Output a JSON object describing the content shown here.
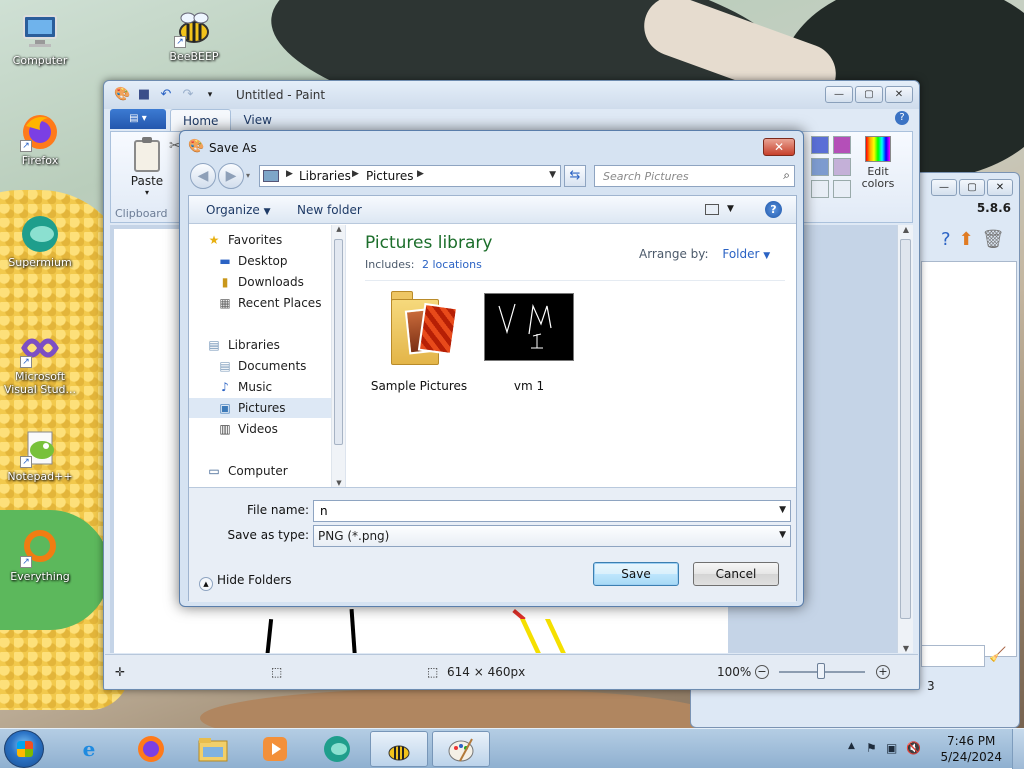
{
  "desktop": {
    "icons": [
      {
        "label": "Computer",
        "icon": "computer-icon"
      },
      {
        "label": "BeeBEEP",
        "icon": "bee-icon"
      },
      {
        "label": "Firefox",
        "icon": "firefox-icon"
      },
      {
        "label": "Supermium",
        "icon": "supermium-icon"
      },
      {
        "label": "Microsoft Visual Stud...",
        "icon": "visual-studio-icon"
      },
      {
        "label": "Notepad++",
        "icon": "notepad-plus-plus-icon"
      },
      {
        "label": "Everything",
        "icon": "everything-search-icon"
      }
    ]
  },
  "paint": {
    "title": "Untitled - Paint",
    "tabs": [
      "Home",
      "View"
    ],
    "paste_label": "Paste",
    "clipboard_group": "Clipboard",
    "edit_colors": "Edit colors",
    "canvas_size": "614 × 460px",
    "zoom": "100%",
    "swatch_colors": [
      "#5a6fd6",
      "#b44fb8",
      "#7d9bcf",
      "#c4b0d8",
      "#e8eef6",
      "#e8eef6"
    ]
  },
  "bg_window": {
    "version": "5.8.6",
    "number": "3"
  },
  "save_dialog": {
    "title": "Save As",
    "breadcrumb": [
      "Libraries",
      "Pictures"
    ],
    "search_placeholder": "Search Pictures",
    "toolbar": {
      "organize": "Organize",
      "new_folder": "New folder"
    },
    "nav": {
      "favorites": "Favorites",
      "favorites_items": [
        "Desktop",
        "Downloads",
        "Recent Places"
      ],
      "libraries": "Libraries",
      "libraries_items": [
        "Documents",
        "Music",
        "Pictures",
        "Videos"
      ],
      "computer": "Computer",
      "selected": "Pictures"
    },
    "library": {
      "title": "Pictures library",
      "includes_label": "Includes:",
      "includes_link": "2 locations",
      "arrange_label": "Arrange by:",
      "arrange_value": "Folder"
    },
    "files": [
      {
        "name": "Sample Pictures",
        "type": "folder"
      },
      {
        "name": "vm 1",
        "type": "image"
      }
    ],
    "file_name_label": "File name:",
    "file_name_value": "n",
    "save_type_label": "Save as type:",
    "save_type_value": "PNG (*.png)",
    "hide_folders": "Hide Folders",
    "save_button": "Save",
    "cancel_button": "Cancel"
  },
  "taskbar": {
    "apps": [
      "internet-explorer-icon",
      "firefox-icon",
      "file-explorer-icon",
      "media-player-icon",
      "supermium-icon",
      "bee-icon",
      "paint-icon"
    ],
    "time": "7:46 PM",
    "date": "5/24/2024"
  }
}
